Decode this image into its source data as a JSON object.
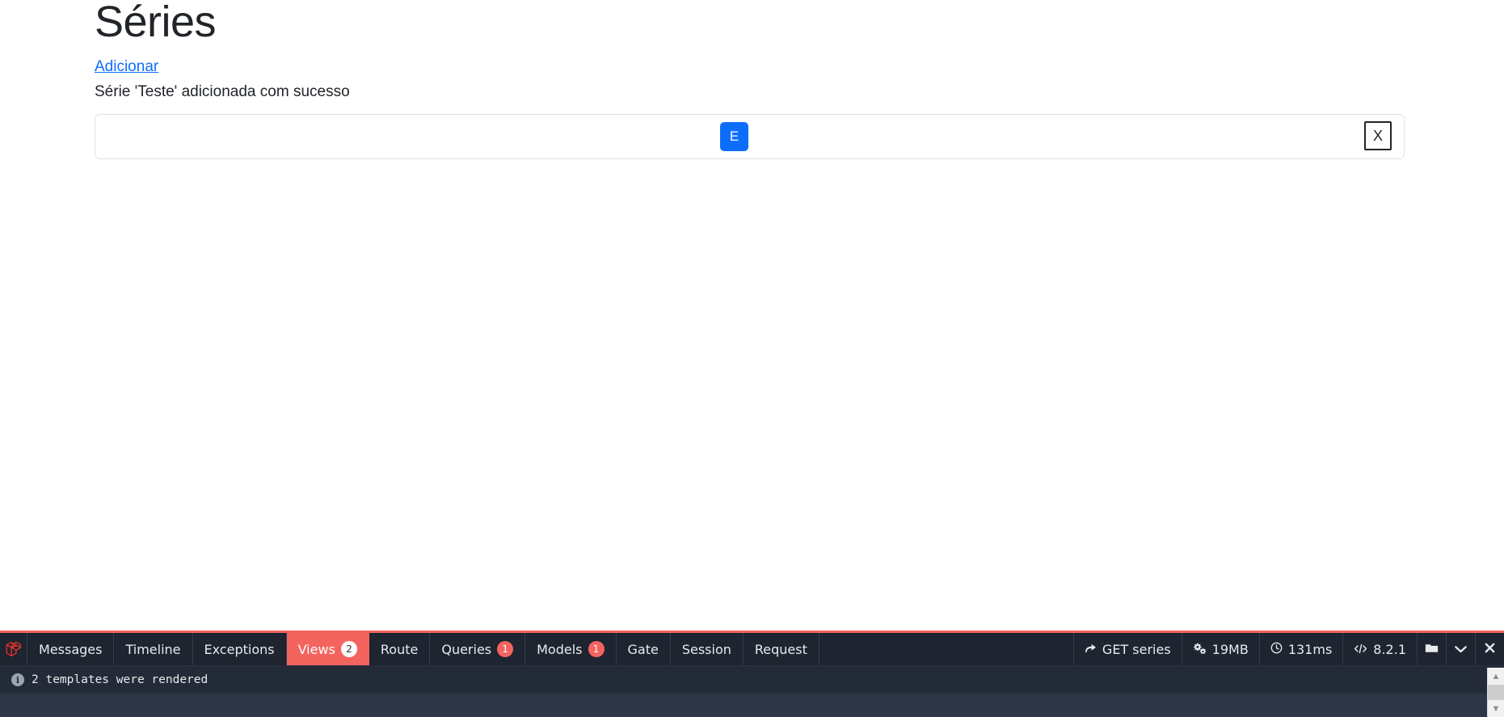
{
  "page": {
    "title": "Séries",
    "add_link": "Adicionar",
    "flash_message": "Série 'Teste' adicionada com sucesso"
  },
  "series_list": [
    {
      "name": "",
      "edit_label": "E",
      "delete_label": "X"
    }
  ],
  "debugbar": {
    "logo_icon": "laravel-logo-icon",
    "tabs": [
      {
        "label": "Messages",
        "badge": null,
        "active": false
      },
      {
        "label": "Timeline",
        "badge": null,
        "active": false
      },
      {
        "label": "Exceptions",
        "badge": null,
        "active": false
      },
      {
        "label": "Views",
        "badge": "2",
        "active": true
      },
      {
        "label": "Route",
        "badge": null,
        "active": false
      },
      {
        "label": "Queries",
        "badge": "1",
        "active": false
      },
      {
        "label": "Models",
        "badge": "1",
        "active": false
      },
      {
        "label": "Gate",
        "badge": null,
        "active": false
      },
      {
        "label": "Session",
        "badge": null,
        "active": false
      },
      {
        "label": "Request",
        "badge": null,
        "active": false
      }
    ],
    "stats": [
      {
        "icon": "arrow-turn-right-icon",
        "label": "GET series"
      },
      {
        "icon": "gears-icon",
        "label": "19MB"
      },
      {
        "icon": "clock-icon",
        "label": "131ms"
      },
      {
        "icon": "code-icon",
        "label": "8.2.1"
      }
    ],
    "actions": [
      {
        "icon": "folder-icon",
        "name": "open-folder-button"
      },
      {
        "icon": "chevron-down-icon",
        "name": "minimize-button"
      },
      {
        "icon": "close-icon",
        "name": "close-debugbar-button"
      }
    ],
    "panel": {
      "info_icon": "info-icon",
      "summary": "2 templates were rendered"
    },
    "accent_color": "#f4645f",
    "background_color": "#1e2430",
    "panel_background": "#242b38"
  },
  "colors": {
    "link": "#0d6efd",
    "primary_button": "#0d6efd",
    "text": "#212529",
    "border": "#dee2e6"
  },
  "scrollbar": {
    "up_arrow": "▲",
    "down_arrow": "▼"
  }
}
